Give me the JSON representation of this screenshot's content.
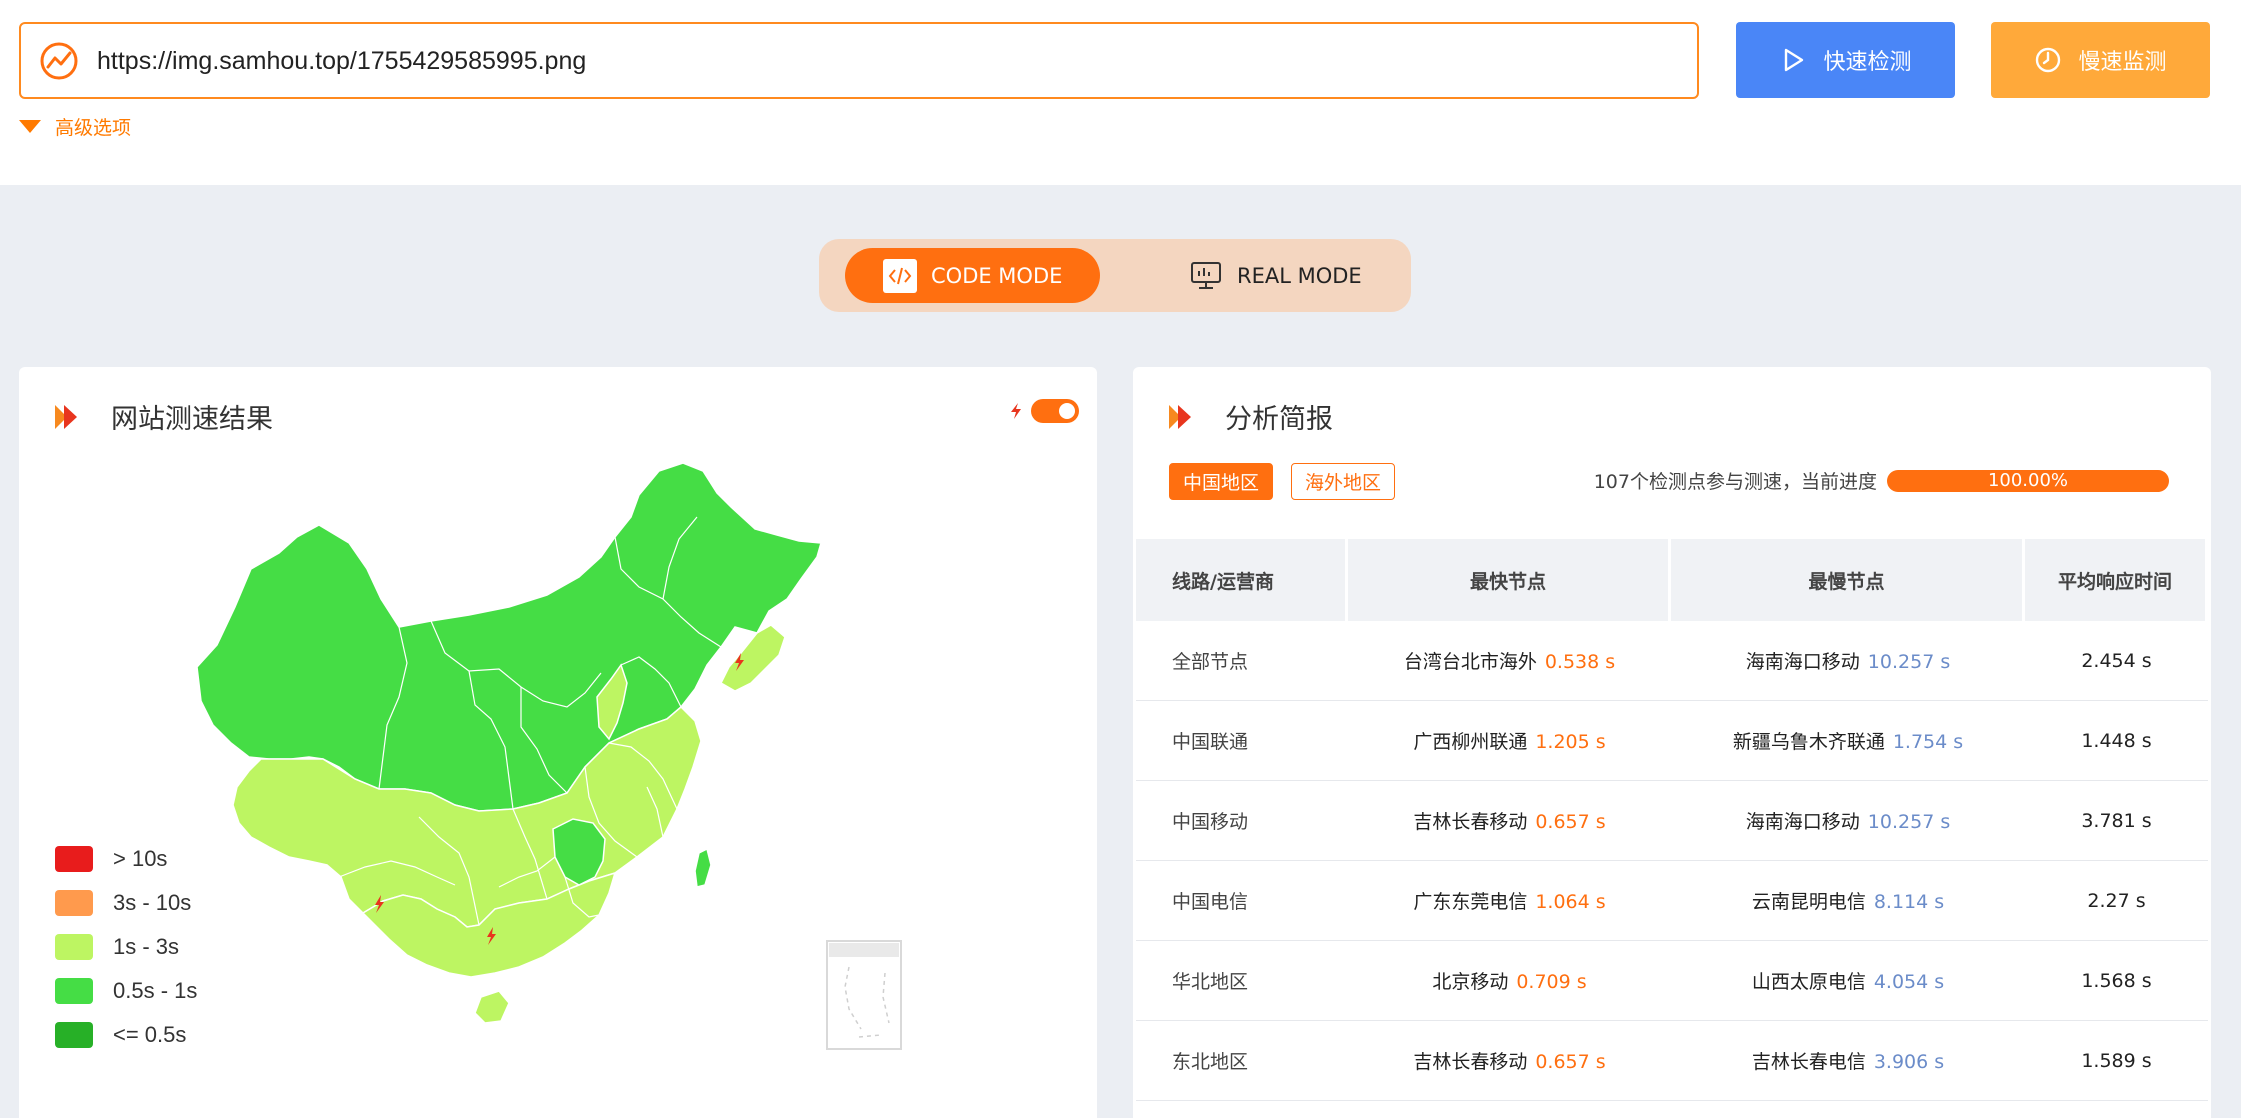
{
  "url_bar": {
    "value": "https://img.samhou.top/1755429585995.png"
  },
  "actions": {
    "fast_check": "快速检测",
    "slow_monitor": "慢速监测"
  },
  "advanced_label": "高级选项",
  "modes": {
    "code": "CODE MODE",
    "real": "REAL MODE",
    "selected": "code"
  },
  "left_panel": {
    "title": "网站测速结果",
    "legend": [
      {
        "label": "> 10s",
        "color": "#e81c1c"
      },
      {
        "label": "3s - 10s",
        "color": "#ff9a4d"
      },
      {
        "label": "1s - 3s",
        "color": "#bdf562"
      },
      {
        "label": "0.5s - 1s",
        "color": "#45dd45"
      },
      {
        "label": "<= 0.5s",
        "color": "#27b027"
      }
    ]
  },
  "right_panel": {
    "title": "分析简报",
    "tabs": [
      {
        "label": "中国地区",
        "active": true
      },
      {
        "label": "海外地区",
        "active": false
      }
    ],
    "progress_text": "107个检测点参与测速，当前进度",
    "progress_value": "100.00%",
    "progress_fraction": 1.0,
    "table": {
      "headers": [
        "线路/运营商",
        "最快节点",
        "最慢节点",
        "平均响应时间"
      ],
      "rows": [
        {
          "name": "全部节点",
          "fast_node": "台湾台北市海外",
          "fast_time": "0.538 s",
          "slow_node": "海南海口移动",
          "slow_time": "10.257 s",
          "avg": "2.454 s"
        },
        {
          "name": "中国联通",
          "fast_node": "广西柳州联通",
          "fast_time": "1.205 s",
          "slow_node": "新疆乌鲁木齐联通",
          "slow_time": "1.754 s",
          "avg": "1.448 s"
        },
        {
          "name": "中国移动",
          "fast_node": "吉林长春移动",
          "fast_time": "0.657 s",
          "slow_node": "海南海口移动",
          "slow_time": "10.257 s",
          "avg": "3.781 s"
        },
        {
          "name": "中国电信",
          "fast_node": "广东东莞电信",
          "fast_time": "1.064 s",
          "slow_node": "云南昆明电信",
          "slow_time": "8.114 s",
          "avg": "2.27 s"
        },
        {
          "name": "华北地区",
          "fast_node": "北京移动",
          "fast_time": "0.709 s",
          "slow_node": "山西太原电信",
          "slow_time": "4.054 s",
          "avg": "1.568 s"
        },
        {
          "name": "东北地区",
          "fast_node": "吉林长春移动",
          "fast_time": "0.657 s",
          "slow_node": "吉林长春电信",
          "slow_time": "3.906 s",
          "avg": "1.589 s"
        }
      ]
    }
  }
}
